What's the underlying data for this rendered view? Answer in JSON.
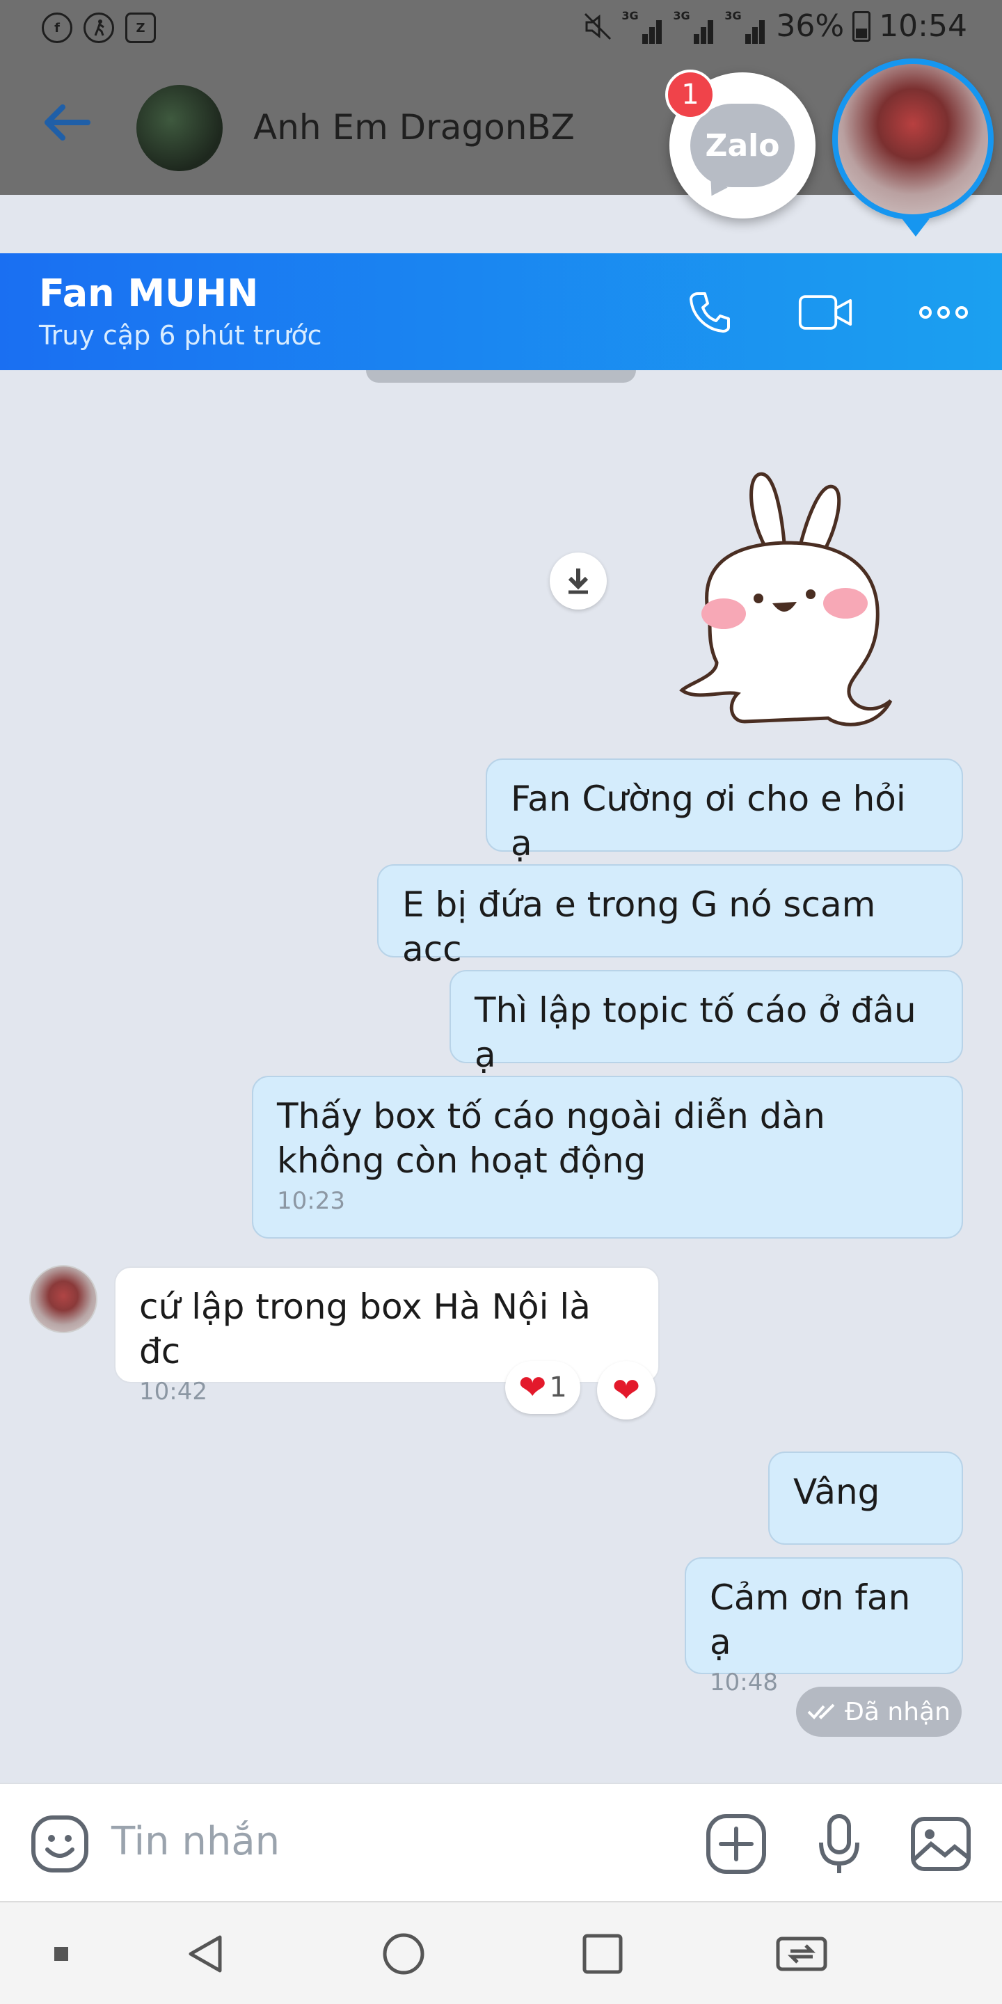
{
  "status_bar": {
    "left_icons": [
      "facebook-notification-icon",
      "activity-icon",
      "zalo-notification-icon"
    ],
    "network_labels": [
      "3G",
      "3G",
      "3G"
    ],
    "battery": "36%",
    "time": "10:54"
  },
  "background_chat": {
    "title": "Anh Em DragonBZ"
  },
  "chat_heads": {
    "zalo_label": "Zalo",
    "zalo_badge": "1"
  },
  "popup_header": {
    "name": "Fan MUHN",
    "status": "Truy cập 6 phút trước"
  },
  "messages": [
    {
      "side": "out",
      "text": "Fan Cường ơi cho e hỏi ạ"
    },
    {
      "side": "out",
      "text": "E bị đứa e trong G nó scam acc"
    },
    {
      "side": "out",
      "text": "Thì lập topic tố cáo ở đâu ạ"
    },
    {
      "side": "out",
      "text": "Thấy box tố cáo ngoài diễn dàn không còn hoạt động",
      "time": "10:23"
    },
    {
      "side": "in",
      "text": "cứ lập trong box Hà Nội là đc",
      "time": "10:42",
      "reaction_count": "1"
    },
    {
      "side": "out",
      "text": "Vâng"
    },
    {
      "side": "out",
      "text": "Cảm ơn fan ạ",
      "time": "10:48"
    }
  ],
  "received_status": "Đã nhận",
  "input": {
    "placeholder": "Tin nhắn"
  },
  "colors": {
    "header_start": "#1a6ff2",
    "header_end": "#1ba0f0",
    "outgoing_bubble": "#d4ecfc",
    "incoming_bubble": "#ffffff",
    "chat_background": "#e2e6ee"
  }
}
